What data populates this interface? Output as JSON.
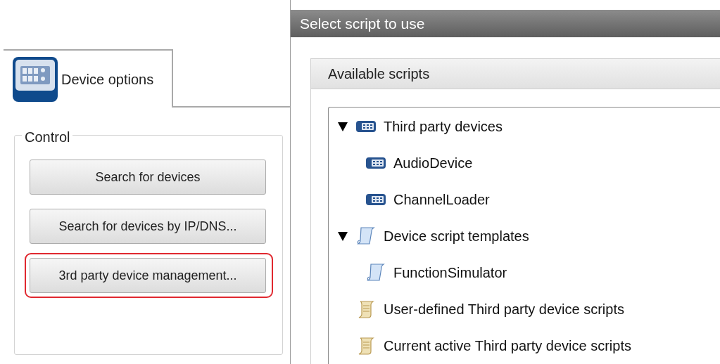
{
  "tab": {
    "label": "Device options",
    "selected": true
  },
  "control_group": {
    "title": "Control",
    "buttons": [
      {
        "label": "Search for devices",
        "highlighted": false
      },
      {
        "label": "Search for devices by IP/DNS...",
        "highlighted": false
      },
      {
        "label": "3rd party device management...",
        "highlighted": true
      }
    ]
  },
  "dialog": {
    "title": "Select script to use",
    "section_title": "Available scripts",
    "tree": [
      {
        "label": "Third party devices",
        "kind": "device",
        "expanded": true,
        "children": [
          {
            "label": "AudioDevice",
            "kind": "device"
          },
          {
            "label": "ChannelLoader",
            "kind": "device"
          }
        ]
      },
      {
        "label": "Device script templates",
        "kind": "template",
        "expanded": true,
        "children": [
          {
            "label": "FunctionSimulator",
            "kind": "template"
          }
        ]
      },
      {
        "label": "User-defined Third party device scripts",
        "kind": "script"
      },
      {
        "label": "Current active Third party device scripts",
        "kind": "script"
      }
    ]
  }
}
